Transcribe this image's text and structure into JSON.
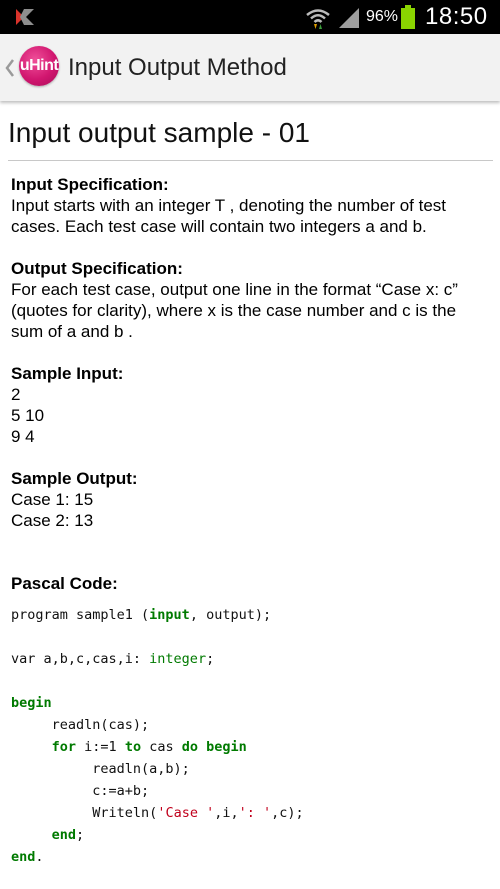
{
  "status_bar": {
    "battery_percent": "96%",
    "time": "18:50",
    "icons": [
      "kaspersky-icon",
      "wifi-icon",
      "signal-icon",
      "battery-icon"
    ]
  },
  "action_bar": {
    "app_icon_text": "uHint",
    "title": "Input Output Method"
  },
  "content": {
    "page_title": "Input output sample - 01",
    "input_spec_heading": "Input Specification:",
    "input_spec_line1": "Input starts with an integer T , denoting the number of test",
    "input_spec_line2": "cases. Each test case will contain two integers a and b.",
    "output_spec_heading": "Output Specification:",
    "output_spec_line1": "For each test case, output one line in the format “Case x: c”",
    "output_spec_line2": "(quotes for clarity), where x is the case number and c is the",
    "output_spec_line3": "sum of a and b .",
    "sample_input_heading": "Sample Input:",
    "sample_input_lines": [
      "2",
      "5 10",
      "9 4"
    ],
    "sample_output_heading": "Sample Output:",
    "sample_output_lines": [
      "Case 1: 15",
      "Case 2: 13"
    ],
    "code_heading": "Pascal Code:"
  },
  "code": {
    "l1_a": "program sample1 (",
    "l1_kw": "input",
    "l1_b": ", output);",
    "l2_a": "var a,b,c,cas,i: ",
    "l2_ty": "integer",
    "l2_b": ";",
    "l3_kw": "begin",
    "l4": "     readln(cas);",
    "l5_indent": "     ",
    "l5_for": "for",
    "l5_a": " i:=1 ",
    "l5_to": "to",
    "l5_b": " cas ",
    "l5_do": "do",
    "l5_sp": " ",
    "l5_begin": "begin",
    "l6": "          readln(a,b);",
    "l7": "          c:=a+b;",
    "l8_a": "          Writeln(",
    "l8_s1": "'Case '",
    "l8_b": ",i,",
    "l8_s2": "': '",
    "l8_c": ",c);",
    "l9_indent": "     ",
    "l9_kw": "end",
    "l9_b": ";",
    "l10_kw": "end",
    "l10_b": "."
  }
}
